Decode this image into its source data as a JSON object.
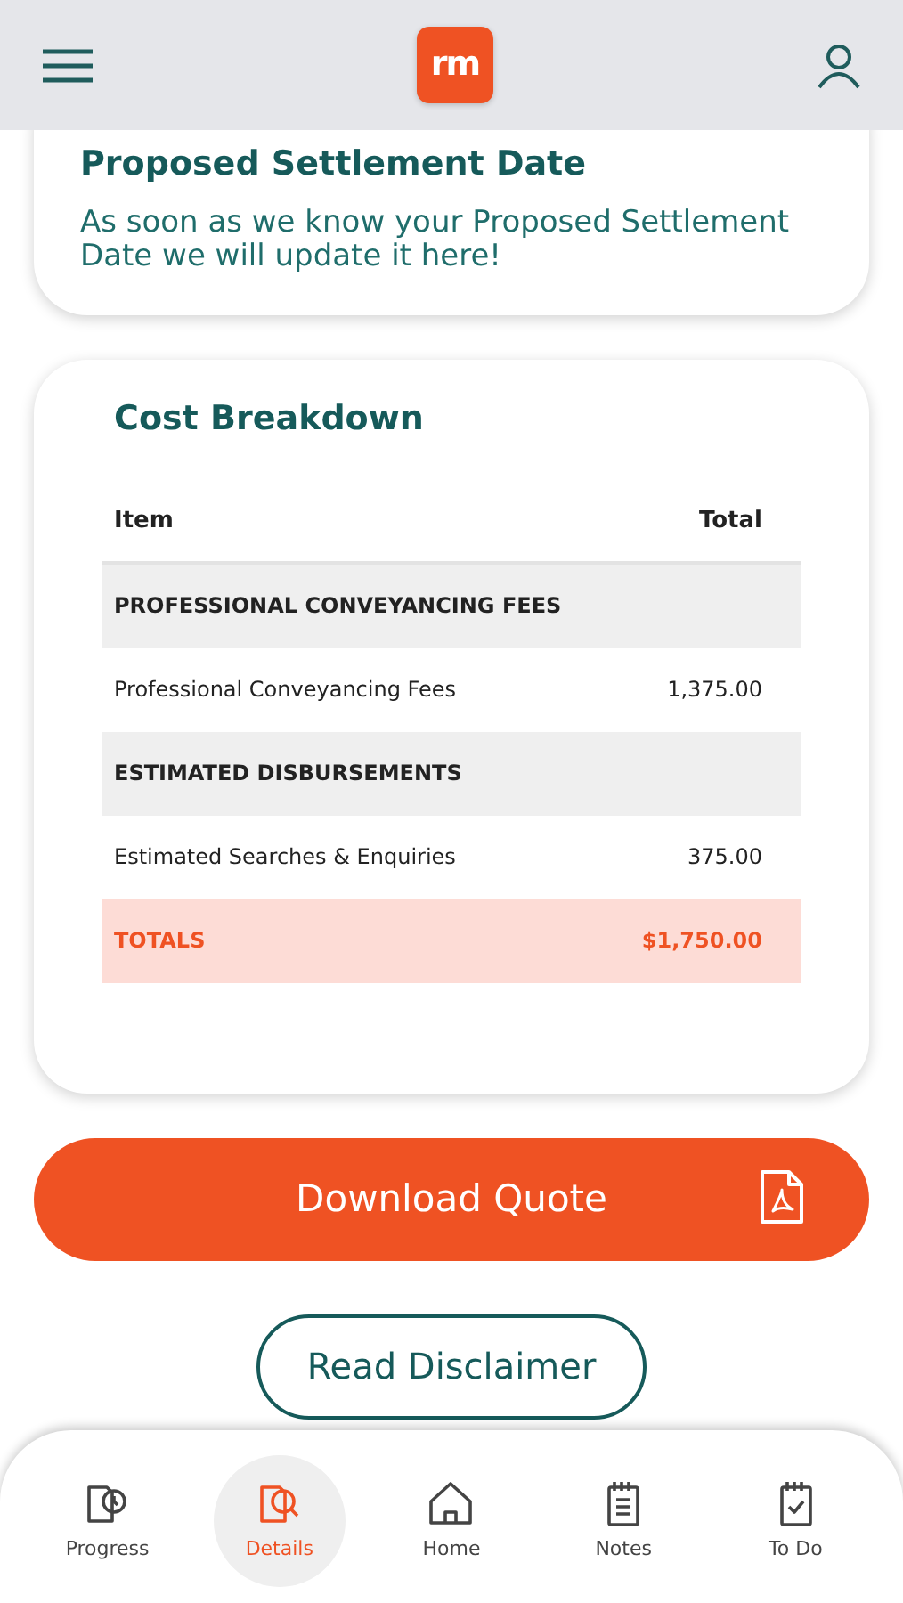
{
  "header": {
    "logo": "rm"
  },
  "settlement": {
    "title": "Proposed Settlement Date",
    "text": "As soon as we know your Proposed Settlement Date we will update it here!"
  },
  "cost_breakdown": {
    "title": "Cost Breakdown",
    "columns": [
      "Item",
      "Total"
    ],
    "rows": [
      {
        "kind": "section",
        "item": "PROFESSIONAL CONVEYANCING FEES"
      },
      {
        "kind": "line",
        "item": "Professional Conveyancing Fees",
        "total": "1,375.00"
      },
      {
        "kind": "section",
        "item": "ESTIMATED DISBURSEMENTS"
      },
      {
        "kind": "line",
        "item": "Estimated Searches & Enquiries",
        "total": "375.00"
      },
      {
        "kind": "total",
        "item": "TOTALS",
        "total": "$1,750.00"
      }
    ]
  },
  "download_button": "Download Quote",
  "disclaimer_button": "Read Disclaimer",
  "bottom_nav": [
    {
      "label": "Progress",
      "kind": "progress",
      "selected": false
    },
    {
      "label": "Details",
      "kind": "details",
      "selected": true
    },
    {
      "label": "Home",
      "kind": "home",
      "selected": false
    },
    {
      "label": "Notes",
      "kind": "notes",
      "selected": false
    },
    {
      "label": "To Do",
      "kind": "todo",
      "selected": false
    }
  ]
}
